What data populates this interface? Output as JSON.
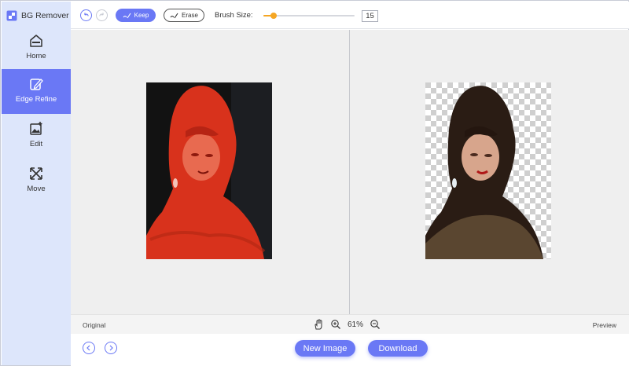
{
  "app": {
    "title": "BG Remover",
    "logo_icon": "bg-remover-logo-icon"
  },
  "sidebar": {
    "items": [
      {
        "label": "Home",
        "icon": "home-icon",
        "active": false
      },
      {
        "label": "Edge Refine",
        "icon": "edge-refine-icon",
        "active": true
      },
      {
        "label": "Edit",
        "icon": "edit-image-icon",
        "active": false
      },
      {
        "label": "Move",
        "icon": "move-arrows-icon",
        "active": false
      }
    ]
  },
  "toolbar": {
    "undo_icon": "undo-icon",
    "redo_icon": "redo-icon",
    "keep_label": "Keep",
    "erase_label": "Erase",
    "brush_size_label": "Brush Size:",
    "brush_size_value": "15",
    "brush_size_fraction": 0.11
  },
  "canvas": {
    "original_label": "Original",
    "preview_label": "Preview",
    "zoom_value": "61%",
    "hand_icon": "hand-pan-icon",
    "zoom_in_icon": "zoom-in-icon",
    "zoom_out_icon": "zoom-out-icon"
  },
  "bottom": {
    "prev_icon": "chevron-left-icon",
    "next_icon": "chevron-right-icon",
    "new_image_label": "New Image",
    "download_label": "Download"
  },
  "colors": {
    "accent": "#6a78f5",
    "sidebar_bg": "#dde6fb",
    "slider_accent": "#f5a623",
    "keep_mask": "#d8321c"
  }
}
